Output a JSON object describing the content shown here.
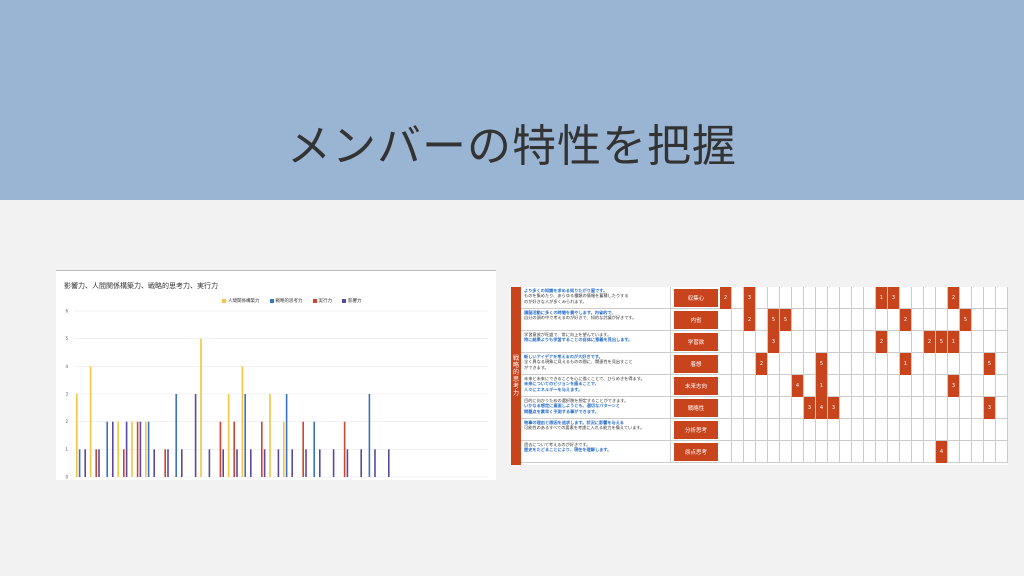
{
  "slide": {
    "title": "メンバーの特性を把握"
  },
  "chart_data": {
    "type": "bar",
    "title": "影響力、人間関係構築力、戦略的思考力、実行力",
    "ylim": [
      0,
      6
    ],
    "yticks": [
      "0",
      "1",
      "2",
      "3",
      "4",
      "5",
      "6"
    ],
    "series": [
      {
        "name": "人間関係構築力",
        "color": "#f4c542",
        "values": [
          3,
          4,
          0,
          2,
          2,
          2,
          0,
          0,
          0,
          5,
          0,
          3,
          4,
          0,
          3,
          2,
          0,
          0,
          0,
          0,
          0,
          0,
          0,
          0,
          0,
          0,
          0,
          0,
          0,
          0
        ]
      },
      {
        "name": "戦略的思考力",
        "color": "#3b73c4",
        "values": [
          1,
          0,
          2,
          0,
          0,
          2,
          0,
          3,
          0,
          0,
          0,
          0,
          3,
          0,
          0,
          3,
          0,
          2,
          0,
          0,
          0,
          3,
          0,
          0,
          0,
          0,
          0,
          0,
          0,
          0
        ]
      },
      {
        "name": "実行力",
        "color": "#d0442b",
        "values": [
          0,
          1,
          0,
          1,
          2,
          0,
          1,
          0,
          0,
          0,
          2,
          2,
          0,
          2,
          0,
          0,
          2,
          0,
          0,
          2,
          0,
          0,
          0,
          0,
          0,
          0,
          0,
          0,
          0,
          0
        ]
      },
      {
        "name": "影響力",
        "color": "#5b4a9c",
        "values": [
          1,
          1,
          2,
          2,
          2,
          1,
          1,
          1,
          3,
          1,
          1,
          1,
          1,
          1,
          1,
          1,
          1,
          1,
          1,
          1,
          1,
          1,
          1,
          0,
          0,
          0,
          0,
          0,
          0,
          0
        ]
      }
    ]
  },
  "table": {
    "side_label": "戦略的思考力",
    "rows": [
      {
        "lines": [
          "より多くの知識を求める知りたがり屋です。",
          "ものを集めたり、あらゆる種類の情報を蓄積したりする",
          "のが好きな人が多くみられます。"
        ],
        "hl": [
          0
        ],
        "label": "収集心",
        "cells": {
          "0": "2",
          "2": "3",
          "13": "1",
          "14": "3",
          "19": "2"
        }
      },
      {
        "lines": [
          "頭脳活動に多くの時間を費やします。内省的で、",
          "自分の頭の中で考えるのが好きで、知的な討議が好きです。"
        ],
        "hl": [
          0
        ],
        "label": "内省",
        "cells": {
          "2": "2",
          "4": "5",
          "5": "5",
          "15": "2",
          "20": "5"
        }
      },
      {
        "lines": [
          "学習意欲が旺盛で、常に向上を望んでいます。",
          "特に結果よりも学習することの自体に意義を見出します。"
        ],
        "hl": [
          1
        ],
        "label": "学習欲",
        "cells": {
          "4": "3",
          "13": "2",
          "17": "2",
          "18": "5",
          "19": "1"
        }
      },
      {
        "lines": [
          "新しいアイデアを考えるのが大好きです。",
          "全く異なる現象に見えるものの間に、関連性を見出すこと",
          "ができます。"
        ],
        "hl": [
          0
        ],
        "label": "着想",
        "cells": {
          "3": "2",
          "8": "5",
          "15": "1",
          "22": "5"
        }
      },
      {
        "lines": [
          "未来と未来にできることを心に描くことで、ひらめきを得ます。",
          "未来についてのビジョンを語ることで、",
          "人々にエネルギーを与えます。"
        ],
        "hl": [
          1,
          2
        ],
        "label": "未来志向",
        "cells": {
          "6": "4",
          "8": "1",
          "19": "3"
        }
      },
      {
        "lines": [
          "目的に向かうための選択肢を想定することができます。",
          "いかなる想定に直面しようとも、適切なパターンと",
          "問題点を素早く予測する事ができます。"
        ],
        "hl": [
          1,
          2
        ],
        "label": "戦略性",
        "cells": {
          "7": "3",
          "8": "4",
          "9": "3",
          "22": "3"
        }
      },
      {
        "lines": [
          "物事の理由と原因を追求します。状況に影響を与える",
          "可能性のあるすべての要素を考慮に入れる能力を備えています。"
        ],
        "hl": [
          0
        ],
        "label": "分析思考",
        "cells": {}
      },
      {
        "lines": [
          "過去について考えるのが好きです。",
          "歴史をたどることにより、現在を理解します。"
        ],
        "hl": [
          1
        ],
        "label": "原点思考",
        "cells": {
          "18": "4"
        }
      }
    ]
  }
}
